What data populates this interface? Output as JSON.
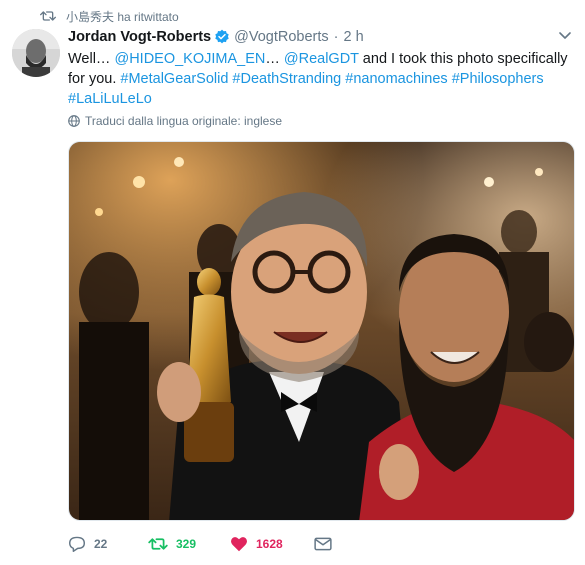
{
  "retweet_header": {
    "text": "小島秀夫 ha ritwittato"
  },
  "tweet": {
    "display_name": "Jordan Vogt-Roberts",
    "handle": "@VogtRoberts",
    "separator": "·",
    "time": "2 h",
    "text_parts": [
      {
        "type": "text",
        "value": "Well… "
      },
      {
        "type": "mention",
        "value": "@HIDEO_KOJIMA_EN"
      },
      {
        "type": "text",
        "value": "… "
      },
      {
        "type": "mention",
        "value": "@RealGDT"
      },
      {
        "type": "text",
        "value": " and I took this photo specifically for you. "
      },
      {
        "type": "hashtag",
        "value": "#MetalGearSolid"
      },
      {
        "type": "text",
        "value": " "
      },
      {
        "type": "hashtag",
        "value": "#DeathStranding"
      },
      {
        "type": "text",
        "value": " "
      },
      {
        "type": "hashtag",
        "value": "#nanomachines"
      },
      {
        "type": "text",
        "value": " "
      },
      {
        "type": "hashtag",
        "value": "#Philosophers"
      },
      {
        "type": "text",
        "value": " "
      },
      {
        "type": "hashtag",
        "value": "#LaLiLuLeLo"
      }
    ],
    "translate_label": "Traduci dalla lingua originale: inglese"
  },
  "actions": {
    "reply_count": "22",
    "retweet_count": "329",
    "like_count": "1628"
  },
  "icons": {
    "retweet_header": "retweet-icon",
    "verified": "verified-badge-icon",
    "caret": "chevron-down-icon",
    "translate": "globe-icon",
    "reply": "reply-icon",
    "retweet": "retweet-icon",
    "like": "heart-icon",
    "dm": "envelope-icon"
  },
  "colors": {
    "link": "#1b95e0",
    "retweet_active": "#17bf63",
    "like_active": "#e0245e",
    "secondary_text": "#657786"
  }
}
